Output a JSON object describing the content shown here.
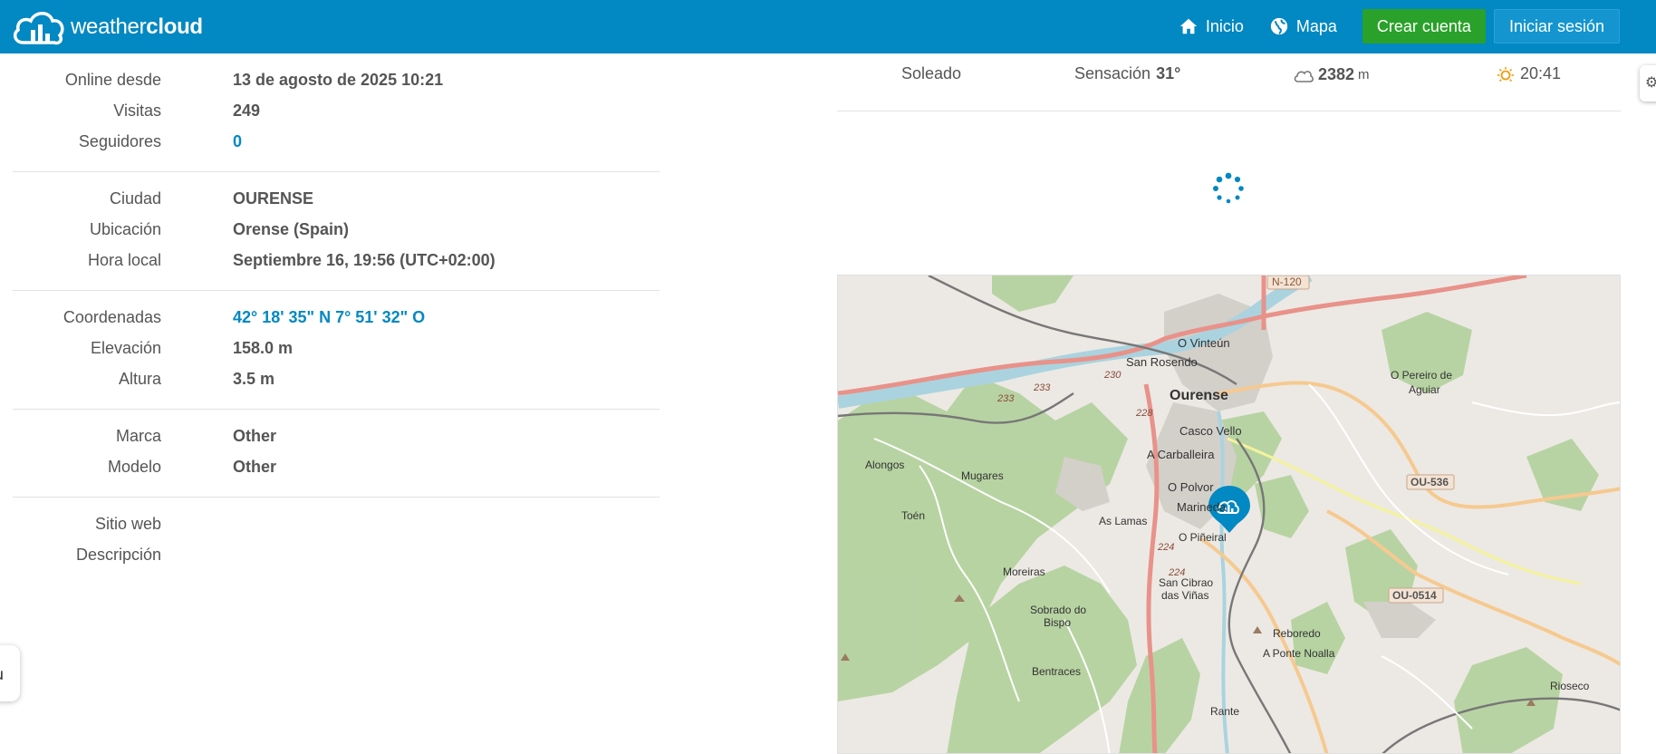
{
  "header": {
    "logo_light": "weather",
    "logo_bold": "cloud",
    "nav_home": "Inicio",
    "nav_map": "Mapa",
    "create_account": "Crear cuenta",
    "login": "Iniciar sesión"
  },
  "info": {
    "online_label": "Online desde",
    "online_value": "13 de agosto de 2025 10:21",
    "visits_label": "Visitas",
    "visits_value": "249",
    "followers_label": "Seguidores",
    "followers_value": "0",
    "city_label": "Ciudad",
    "city_value": "OURENSE",
    "location_label": "Ubicación",
    "location_value": "Orense (Spain)",
    "local_time_label": "Hora local",
    "local_time_value": "Septiembre 16, 19:56 (UTC+02:00)",
    "coords_label": "Coordenadas",
    "coords_value": "42° 18' 35\" N  7° 51' 32\" O",
    "elevation_label": "Elevación",
    "elevation_value": "158.0 m",
    "height_label": "Altura",
    "height_value": "3.5 m",
    "brand_label": "Marca",
    "brand_value": "Other",
    "model_label": "Modelo",
    "model_value": "Other",
    "website_label": "Sitio web",
    "description_label": "Descripción"
  },
  "summary": {
    "condition": "Soleado",
    "feels_label": "Sensación",
    "feels_value": "31°",
    "cloud_base_value": "2382",
    "cloud_base_unit": "m",
    "sunset": "20:41"
  },
  "map": {
    "labels": {
      "n120": "N-120",
      "o_vinteun": "O Vinteún",
      "san_rosendo": "San Rosendo",
      "ourense": "Ourense",
      "o_pereiro": "O Pereiro de",
      "aguiar": "Aguiar",
      "casco_vello": "Casco Vello",
      "a_carballeira": "A Carballeira",
      "alongos": "Alongos",
      "mugares": "Mugares",
      "o_polvo": "O Polvor",
      "marineda": "Marineda",
      "ou536": "OU-536",
      "toen": "Toén",
      "as_lamas": "As Lamas",
      "o_pineiral": "O Piñeiral",
      "moreiras": "Moreiras",
      "san_cibrao": "San Cibrao",
      "das_vinas": "das Viñas",
      "ou0514": "OU-0514",
      "sobrado": "Sobrado do",
      "bispo": "Bispo",
      "reboredo": "Reboredo",
      "a_ponte": "A Ponte Noalla",
      "bentraces": "Bentraces",
      "rioseco": "Rioseco",
      "rante": "Rante",
      "r230": "230",
      "r233a": "233",
      "r233b": "233",
      "r228": "228",
      "r224a": "224",
      "r224b": "224"
    }
  }
}
